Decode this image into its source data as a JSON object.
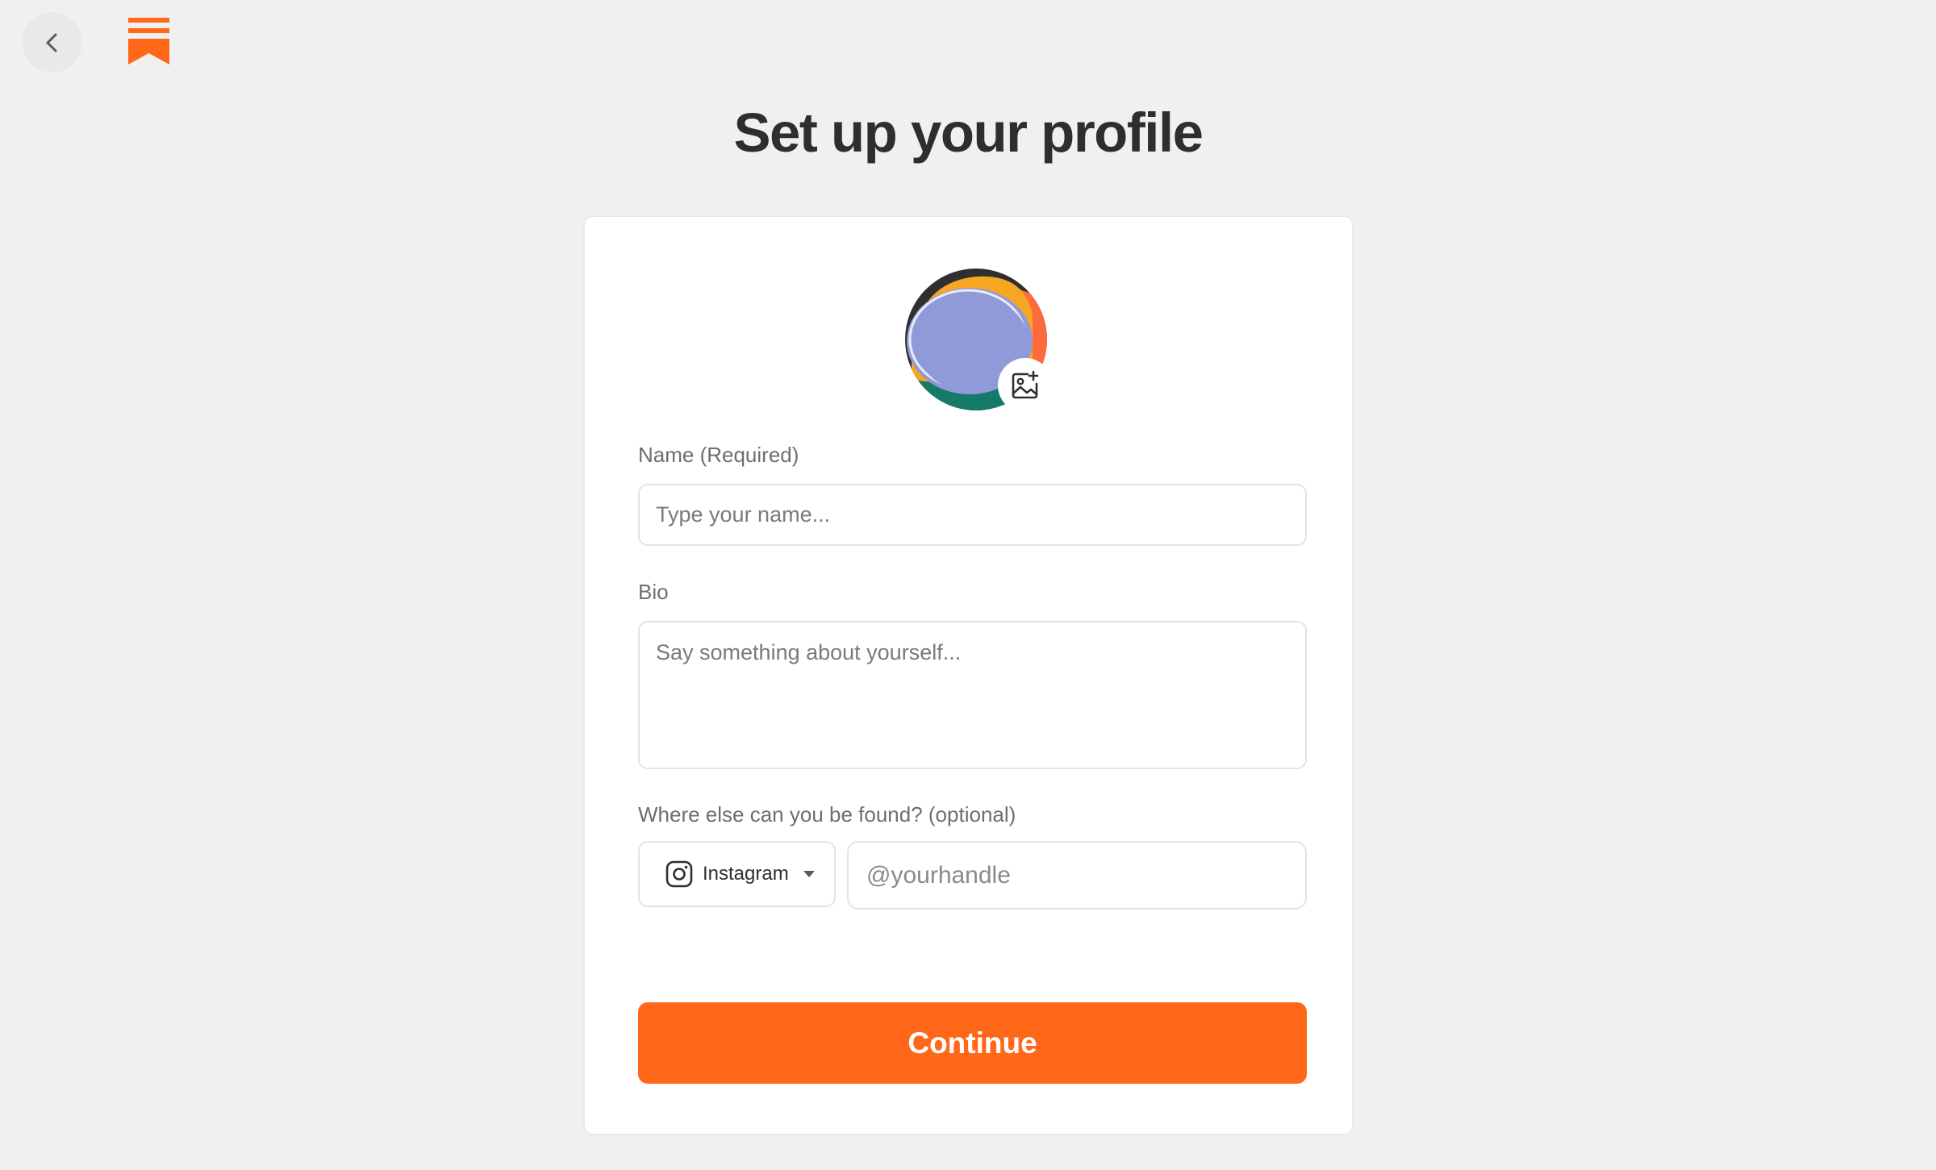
{
  "header": {
    "back_icon": "chevron-left-icon",
    "logo_icon": "bookmark-logo-icon",
    "brand_color": "#ff6719"
  },
  "page": {
    "title": "Set up your profile"
  },
  "avatar": {
    "edit_icon": "image-add-icon"
  },
  "form": {
    "name_label": "Name (Required)",
    "name_placeholder": "Type your name...",
    "name_value": "",
    "bio_label": "Bio",
    "bio_placeholder": "Say something about yourself...",
    "bio_value": "",
    "social_label": "Where else can you be found? (optional)",
    "social_platform": "Instagram",
    "social_platform_icon": "instagram-icon",
    "social_handle_placeholder": "@yourhandle",
    "social_handle_value": "",
    "continue_label": "Continue"
  }
}
